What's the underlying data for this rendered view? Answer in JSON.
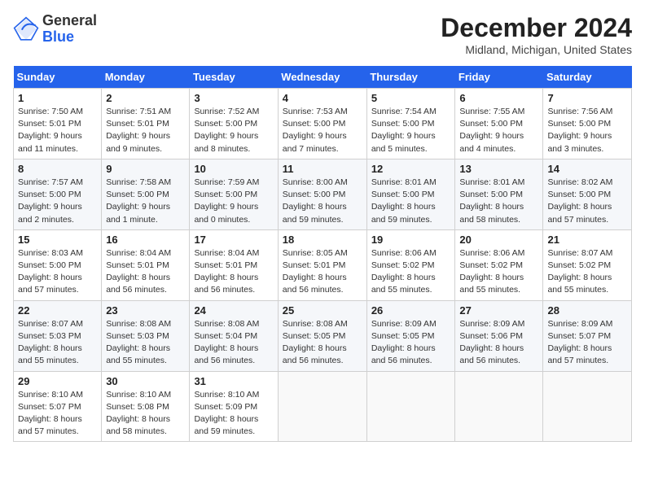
{
  "header": {
    "logo_general": "General",
    "logo_blue": "Blue",
    "title": "December 2024",
    "location": "Midland, Michigan, United States"
  },
  "calendar": {
    "weekdays": [
      "Sunday",
      "Monday",
      "Tuesday",
      "Wednesday",
      "Thursday",
      "Friday",
      "Saturday"
    ],
    "weeks": [
      [
        {
          "day": "1",
          "sunrise": "7:50 AM",
          "sunset": "5:01 PM",
          "daylight": "9 hours and 11 minutes."
        },
        {
          "day": "2",
          "sunrise": "7:51 AM",
          "sunset": "5:01 PM",
          "daylight": "9 hours and 9 minutes."
        },
        {
          "day": "3",
          "sunrise": "7:52 AM",
          "sunset": "5:00 PM",
          "daylight": "9 hours and 8 minutes."
        },
        {
          "day": "4",
          "sunrise": "7:53 AM",
          "sunset": "5:00 PM",
          "daylight": "9 hours and 7 minutes."
        },
        {
          "day": "5",
          "sunrise": "7:54 AM",
          "sunset": "5:00 PM",
          "daylight": "9 hours and 5 minutes."
        },
        {
          "day": "6",
          "sunrise": "7:55 AM",
          "sunset": "5:00 PM",
          "daylight": "9 hours and 4 minutes."
        },
        {
          "day": "7",
          "sunrise": "7:56 AM",
          "sunset": "5:00 PM",
          "daylight": "9 hours and 3 minutes."
        }
      ],
      [
        {
          "day": "8",
          "sunrise": "7:57 AM",
          "sunset": "5:00 PM",
          "daylight": "9 hours and 2 minutes."
        },
        {
          "day": "9",
          "sunrise": "7:58 AM",
          "sunset": "5:00 PM",
          "daylight": "9 hours and 1 minute."
        },
        {
          "day": "10",
          "sunrise": "7:59 AM",
          "sunset": "5:00 PM",
          "daylight": "9 hours and 0 minutes."
        },
        {
          "day": "11",
          "sunrise": "8:00 AM",
          "sunset": "5:00 PM",
          "daylight": "8 hours and 59 minutes."
        },
        {
          "day": "12",
          "sunrise": "8:01 AM",
          "sunset": "5:00 PM",
          "daylight": "8 hours and 59 minutes."
        },
        {
          "day": "13",
          "sunrise": "8:01 AM",
          "sunset": "5:00 PM",
          "daylight": "8 hours and 58 minutes."
        },
        {
          "day": "14",
          "sunrise": "8:02 AM",
          "sunset": "5:00 PM",
          "daylight": "8 hours and 57 minutes."
        }
      ],
      [
        {
          "day": "15",
          "sunrise": "8:03 AM",
          "sunset": "5:00 PM",
          "daylight": "8 hours and 57 minutes."
        },
        {
          "day": "16",
          "sunrise": "8:04 AM",
          "sunset": "5:01 PM",
          "daylight": "8 hours and 56 minutes."
        },
        {
          "day": "17",
          "sunrise": "8:04 AM",
          "sunset": "5:01 PM",
          "daylight": "8 hours and 56 minutes."
        },
        {
          "day": "18",
          "sunrise": "8:05 AM",
          "sunset": "5:01 PM",
          "daylight": "8 hours and 56 minutes."
        },
        {
          "day": "19",
          "sunrise": "8:06 AM",
          "sunset": "5:02 PM",
          "daylight": "8 hours and 55 minutes."
        },
        {
          "day": "20",
          "sunrise": "8:06 AM",
          "sunset": "5:02 PM",
          "daylight": "8 hours and 55 minutes."
        },
        {
          "day": "21",
          "sunrise": "8:07 AM",
          "sunset": "5:02 PM",
          "daylight": "8 hours and 55 minutes."
        }
      ],
      [
        {
          "day": "22",
          "sunrise": "8:07 AM",
          "sunset": "5:03 PM",
          "daylight": "8 hours and 55 minutes."
        },
        {
          "day": "23",
          "sunrise": "8:08 AM",
          "sunset": "5:03 PM",
          "daylight": "8 hours and 55 minutes."
        },
        {
          "day": "24",
          "sunrise": "8:08 AM",
          "sunset": "5:04 PM",
          "daylight": "8 hours and 56 minutes."
        },
        {
          "day": "25",
          "sunrise": "8:08 AM",
          "sunset": "5:05 PM",
          "daylight": "8 hours and 56 minutes."
        },
        {
          "day": "26",
          "sunrise": "8:09 AM",
          "sunset": "5:05 PM",
          "daylight": "8 hours and 56 minutes."
        },
        {
          "day": "27",
          "sunrise": "8:09 AM",
          "sunset": "5:06 PM",
          "daylight": "8 hours and 56 minutes."
        },
        {
          "day": "28",
          "sunrise": "8:09 AM",
          "sunset": "5:07 PM",
          "daylight": "8 hours and 57 minutes."
        }
      ],
      [
        {
          "day": "29",
          "sunrise": "8:10 AM",
          "sunset": "5:07 PM",
          "daylight": "8 hours and 57 minutes."
        },
        {
          "day": "30",
          "sunrise": "8:10 AM",
          "sunset": "5:08 PM",
          "daylight": "8 hours and 58 minutes."
        },
        {
          "day": "31",
          "sunrise": "8:10 AM",
          "sunset": "5:09 PM",
          "daylight": "8 hours and 59 minutes."
        },
        null,
        null,
        null,
        null
      ]
    ]
  }
}
